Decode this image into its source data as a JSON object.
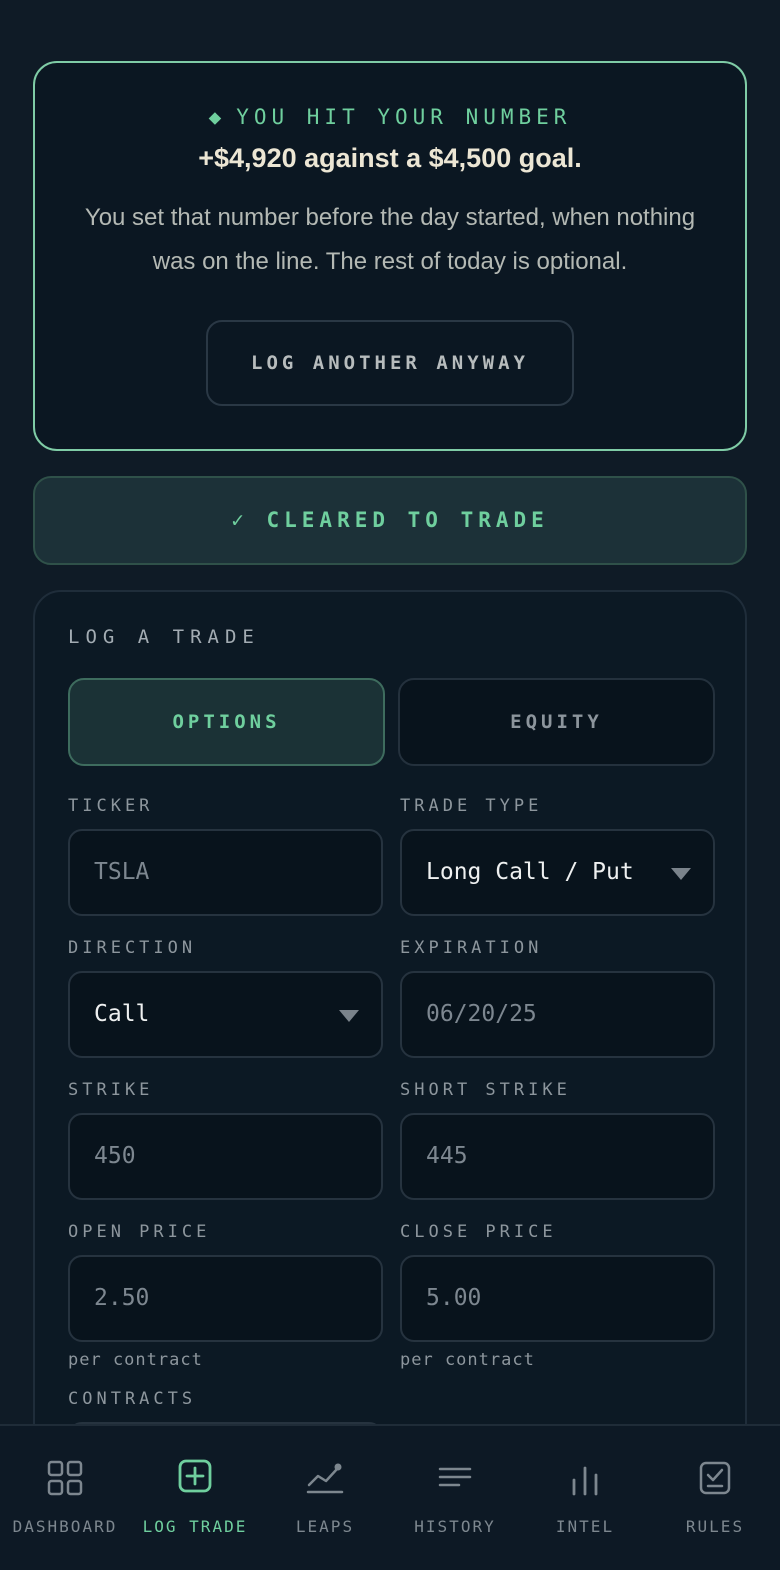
{
  "goal_card": {
    "eyebrow_icon": "diamond-icon",
    "eyebrow_glyph": "◆",
    "eyebrow": "YOU HIT YOUR NUMBER",
    "headline": "+$4,920 against a $4,500 goal.",
    "body": "You set that number before the day started, when nothing was on the line. The rest of today is optional.",
    "button_label": "LOG ANOTHER ANYWAY"
  },
  "cleared_banner": {
    "check_glyph": "✓",
    "label": "CLEARED TO TRADE"
  },
  "log_trade": {
    "title": "LOG A TRADE",
    "toggle": {
      "options_label": "OPTIONS",
      "equity_label": "EQUITY",
      "selected": "OPTIONS"
    },
    "fields": {
      "ticker": {
        "label": "TICKER",
        "placeholder": "TSLA"
      },
      "trade_type": {
        "label": "TRADE TYPE",
        "value": "Long Call / Put"
      },
      "direction": {
        "label": "DIRECTION",
        "value": "Call"
      },
      "expiration": {
        "label": "EXPIRATION",
        "placeholder": "06/20/25"
      },
      "strike": {
        "label": "STRIKE",
        "placeholder": "450"
      },
      "short_strike": {
        "label": "SHORT STRIKE",
        "placeholder": "445"
      },
      "open_price": {
        "label": "OPEN PRICE",
        "placeholder": "2.50",
        "hint": "per contract"
      },
      "close_price": {
        "label": "CLOSE PRICE",
        "placeholder": "5.00",
        "hint": "per contract"
      },
      "contracts": {
        "label": "CONTRACTS"
      }
    }
  },
  "nav": {
    "items": [
      {
        "label": "DASHBOARD",
        "icon": "grid-icon"
      },
      {
        "label": "LOG TRADE",
        "icon": "plus-square-icon",
        "active": true
      },
      {
        "label": "LEAPS",
        "icon": "trend-line-icon"
      },
      {
        "label": "HISTORY",
        "icon": "list-lines-icon"
      },
      {
        "label": "INTEL",
        "icon": "bar-chart-icon"
      },
      {
        "label": "RULES",
        "icon": "checklist-icon"
      }
    ]
  },
  "colors": {
    "background": "#0f1b26",
    "accent": "#6fcf9e",
    "goal_border": "#7fcca6",
    "headline": "#ece6d4"
  }
}
